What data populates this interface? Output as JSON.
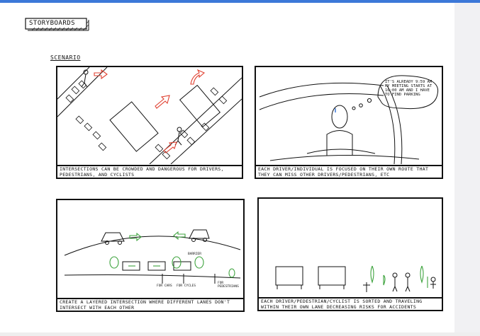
{
  "title": "STORYBOARDS",
  "scenario_label": "SCENARIO",
  "panels": [
    {
      "caption": "INTERSECTIONS CAN BE CROWDED AND DANGEROUS FOR DRIVERS, PEDESTRIANS, AND CYCLISTS"
    },
    {
      "caption": "EACH DRIVER/INDIVIDUAL IS FOCUSED ON THEIR OWN ROUTE THAT THEY CAN MISS OTHER DRIVERS/PEDESTRIANS, ETC",
      "bubble": "IT'S ALREADY 9:59 AM MY MEETING STARTS AT 10:00 AM AND I HAVE TO FIND PARKING"
    },
    {
      "caption": "CREATE A LAYERED INTERSECTION WHERE DIFFERENT LANES DON'T INTERSECT WITH EACH OTHER",
      "labels": {
        "barrier": "BARRIER",
        "for_cars": "FOR CARS",
        "for_cycles": "FOR CYCLES",
        "for_pedestrians": "FOR PEDESTRIANS"
      }
    },
    {
      "caption": "EACH DRIVER/PEDESTRIAN/CYCLIST IS SORTED AND TRAVELING WITHIN THEIR OWN LANE DECREASING RISKS FOR ACCIDENTS"
    }
  ]
}
